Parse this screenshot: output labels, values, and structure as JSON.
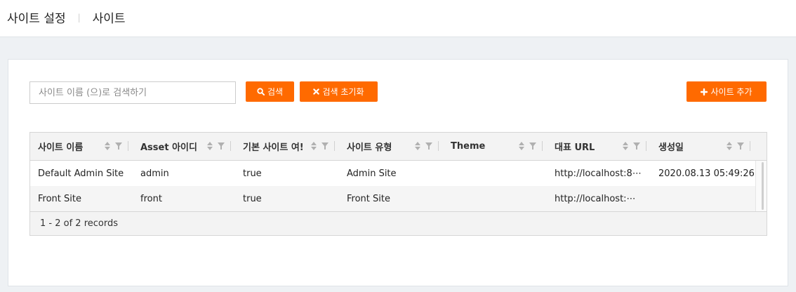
{
  "breadcrumb": {
    "parent": "사이트 설정",
    "separator": "|",
    "current": "사이트"
  },
  "toolbar": {
    "search_placeholder": "사이트 이름 (으)로 검색하기",
    "search_value": "",
    "search_button": "검색",
    "reset_button": "검색 초기화",
    "add_button": "사이트 추가"
  },
  "colors": {
    "accent": "#ff6a00",
    "header_bg": "#f3f3f3",
    "page_bg": "#eef1f4"
  },
  "table": {
    "columns": [
      "사이트 이름",
      "Asset 아이디",
      "기본 사이트 여!",
      "사이트 유형",
      "Theme",
      "대표 URL",
      "생성일"
    ],
    "rows": [
      [
        "Default Admin Site",
        "admin",
        "true",
        "Admin Site",
        "",
        "http://localhost:8⋯",
        "2020.08.13 05:49:26"
      ],
      [
        "Front Site",
        "front",
        "true",
        "Front Site",
        "",
        "http://localhost:⋯",
        ""
      ]
    ],
    "footer": "1 - 2 of 2 records"
  },
  "icons": {
    "search_button": "search-icon",
    "reset_button": "close-icon",
    "add_button": "plus-icon",
    "column_sort": "sort-icon",
    "column_filter": "filter-icon"
  }
}
